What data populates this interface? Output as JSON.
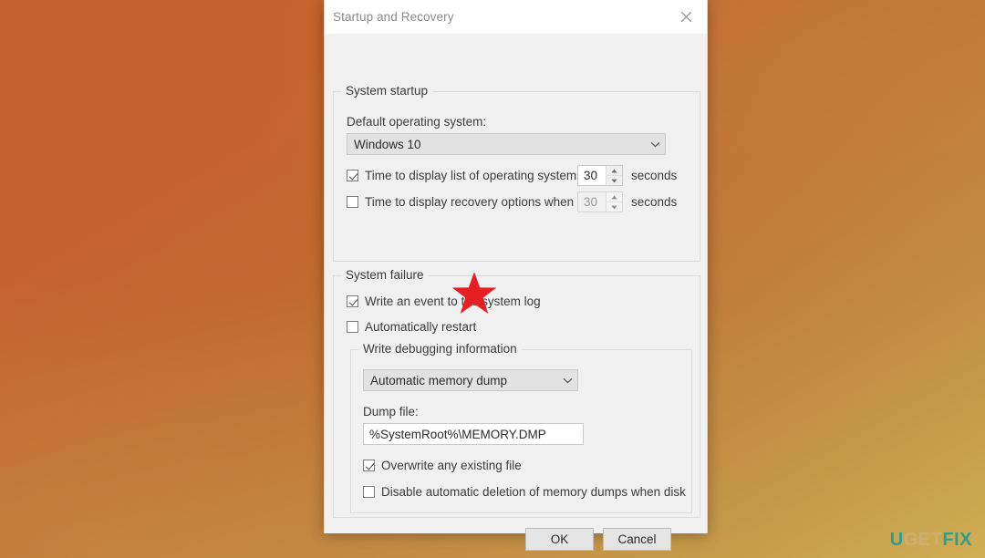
{
  "desktop": {
    "wallpaper_colors": [
      "#c5612c",
      "#cfae55"
    ],
    "watermark": {
      "part1": "U",
      "part2": "GET",
      "part3": "FIX",
      "color_accent": "#2f9e8f",
      "color_muted": "#cfae74"
    }
  },
  "dialog": {
    "title": "Startup and Recovery",
    "close_label": "✕",
    "groups": {
      "system_startup": {
        "label": "System startup",
        "default_os_label": "Default operating system:",
        "default_os_value": "Windows 10",
        "timeout_os": {
          "label": "Time to display list of operating systems:",
          "checked": true,
          "value": "30",
          "unit": "seconds"
        },
        "timeout_recovery": {
          "label": "Time to display recovery options when needed",
          "checked": false,
          "value": "30",
          "unit": "seconds"
        }
      },
      "system_failure": {
        "label": "System failure",
        "write_event": {
          "label": "Write an event to the system log",
          "checked": true
        },
        "auto_restart": {
          "label": "Automatically restart",
          "checked": false
        },
        "write_debug": {
          "label": "Write debugging information",
          "dump_type_value": "Automatic memory dump",
          "dump_file_label": "Dump file:",
          "dump_file_value": "%SystemRoot%\\MEMORY.DMP",
          "overwrite": {
            "label": "Overwrite any existing file",
            "checked": true
          },
          "disable_deletion": {
            "label": "Disable automatic deletion of memory dumps when disk space is l",
            "checked": false
          }
        }
      }
    },
    "buttons": {
      "ok": "OK",
      "cancel": "Cancel"
    }
  },
  "annotation": {
    "type": "red-star",
    "color": "#e51f24",
    "points_at": "Automatically restart"
  }
}
